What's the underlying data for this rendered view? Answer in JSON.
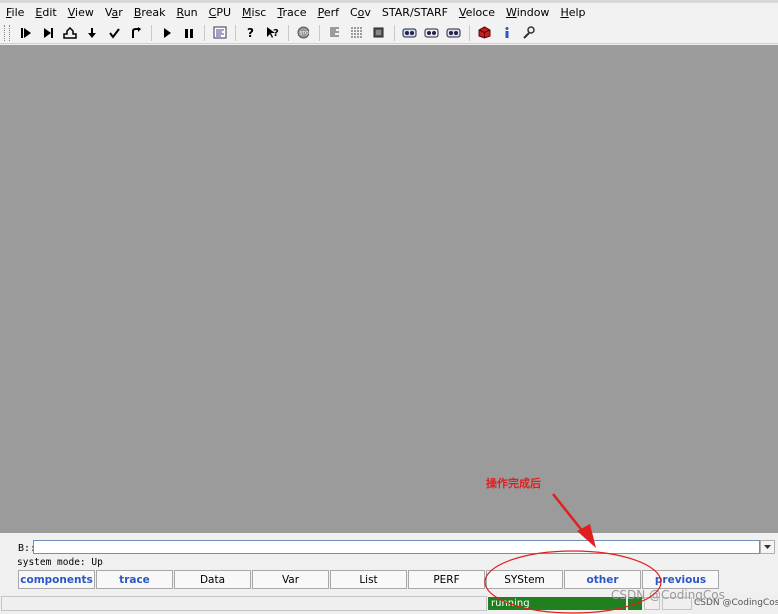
{
  "menu": [
    {
      "pre": "",
      "ul": "F",
      "post": "ile"
    },
    {
      "pre": "",
      "ul": "E",
      "post": "dit"
    },
    {
      "pre": "",
      "ul": "V",
      "post": "iew"
    },
    {
      "pre": "V",
      "ul": "a",
      "post": "r"
    },
    {
      "pre": "",
      "ul": "B",
      "post": "reak"
    },
    {
      "pre": "",
      "ul": "R",
      "post": "un"
    },
    {
      "pre": "",
      "ul": "C",
      "post": "PU"
    },
    {
      "pre": "",
      "ul": "M",
      "post": "isc"
    },
    {
      "pre": "",
      "ul": "T",
      "post": "race"
    },
    {
      "pre": "",
      "ul": "P",
      "post": "erf"
    },
    {
      "pre": "C",
      "ul": "o",
      "post": "v"
    },
    {
      "pre": "STAR/STARF",
      "ul": "",
      "post": ""
    },
    {
      "pre": "",
      "ul": "V",
      "post": "eloce"
    },
    {
      "pre": "",
      "ul": "W",
      "post": "indow"
    },
    {
      "pre": "",
      "ul": "H",
      "post": "elp"
    }
  ],
  "toolbar_icons": [
    "step-icon",
    "step-over-icon",
    "step-up-icon",
    "step-down-icon",
    "return-icon",
    "undo-step-icon",
    "go-icon",
    "break-icon",
    "list-icon",
    "help-icon",
    "context-help-icon",
    "stop-icon",
    "data-dump-icon",
    "register-icon",
    "cpu-icon",
    "trace-list-icon",
    "trace-chart-icon",
    "trace-profile-icon",
    "cube-icon",
    "info-icon",
    "wrench-icon"
  ],
  "command": {
    "prompt": "B::",
    "value": ""
  },
  "system_mode": "system mode: Up",
  "softkeys": [
    {
      "label": "components",
      "link": true
    },
    {
      "label": "trace",
      "link": true
    },
    {
      "label": "Data",
      "link": false
    },
    {
      "label": "Var",
      "link": false
    },
    {
      "label": "List",
      "link": false
    },
    {
      "label": "PERF",
      "link": false
    },
    {
      "label": "SYStem",
      "link": false
    },
    {
      "label": "other",
      "link": true
    },
    {
      "label": "previous",
      "link": true
    }
  ],
  "status": {
    "state": "running",
    "right_text": "CSDN @CodingCos"
  },
  "annotation": {
    "text": "操作完成后"
  },
  "watermark": "CSDN @CodingCos",
  "colors": {
    "workspace": "#9b9b9b",
    "running": "#208020",
    "link": "#2a56c6",
    "annotation": "#e02020"
  }
}
